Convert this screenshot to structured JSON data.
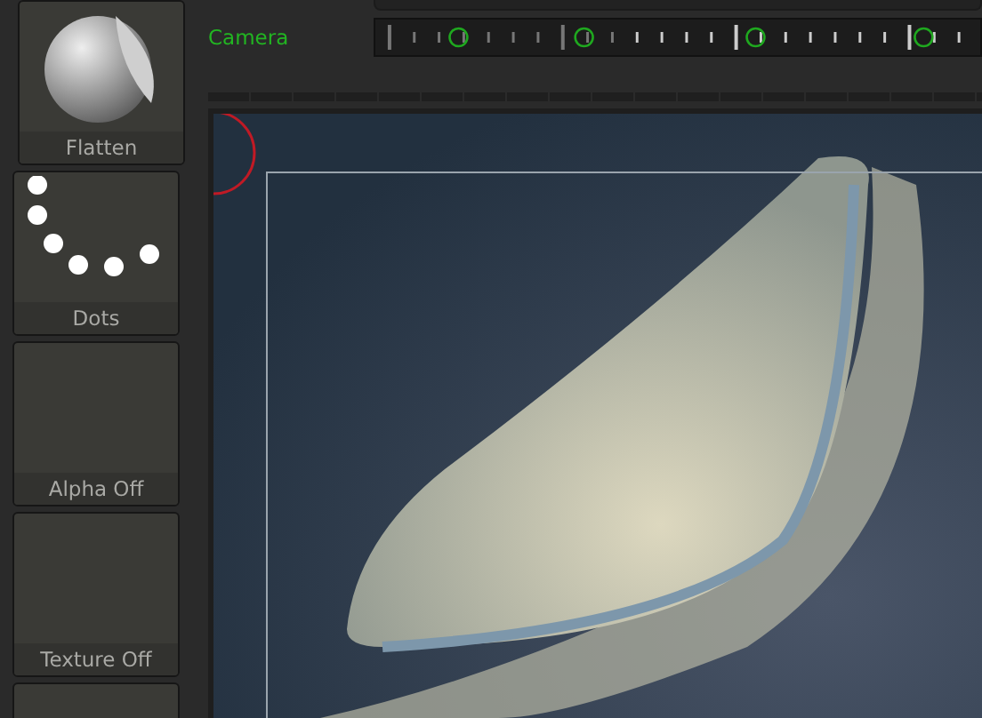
{
  "tools": [
    {
      "kind": "brush",
      "label": "Flatten"
    },
    {
      "kind": "stroke",
      "label": "Dots"
    },
    {
      "kind": "empty",
      "label": "Alpha Off"
    },
    {
      "kind": "empty",
      "label": "Texture Off"
    },
    {
      "kind": "material"
    }
  ],
  "timeline": {
    "label": "Camera"
  }
}
